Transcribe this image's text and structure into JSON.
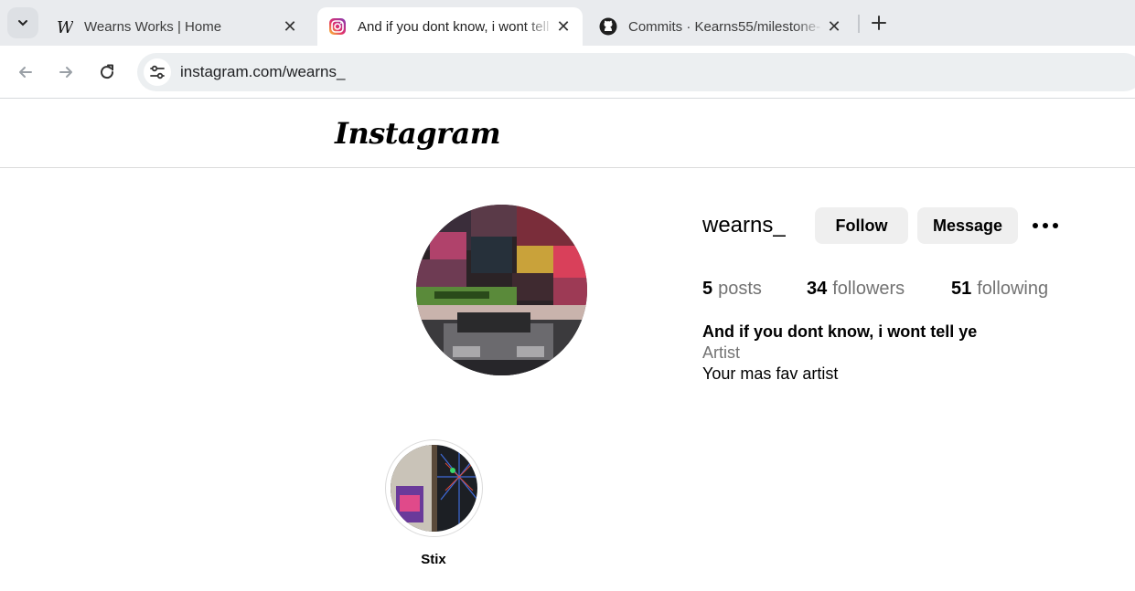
{
  "browser": {
    "tabs": [
      {
        "title": "Wearns Works | Home",
        "favicon": "wearns-w-icon",
        "active": false
      },
      {
        "title": "And if you dont know, i wont tell ye",
        "favicon": "instagram-icon",
        "active": true
      },
      {
        "title": "Commits · Kearns55/milestone-",
        "favicon": "github-icon",
        "active": false
      }
    ],
    "url": "instagram.com/wearns_"
  },
  "instagram": {
    "logo": "Instagram",
    "profile": {
      "username": "wearns_",
      "follow_label": "Follow",
      "message_label": "Message",
      "stats": {
        "posts_count": "5",
        "posts_label": "posts",
        "followers_count": "34",
        "followers_label": "followers",
        "following_count": "51",
        "following_label": "following"
      },
      "bio": {
        "name": "And if you dont know, i wont tell ye",
        "category": "Artist",
        "text": "Your mas fav artist"
      }
    },
    "highlights": [
      {
        "label": "Stix"
      }
    ]
  },
  "colors": {
    "tabstrip": "#e9ebee",
    "omnibox": "#eceff1",
    "button_bg": "#efefef",
    "muted_text": "#737373",
    "border": "#dbdbdb"
  }
}
